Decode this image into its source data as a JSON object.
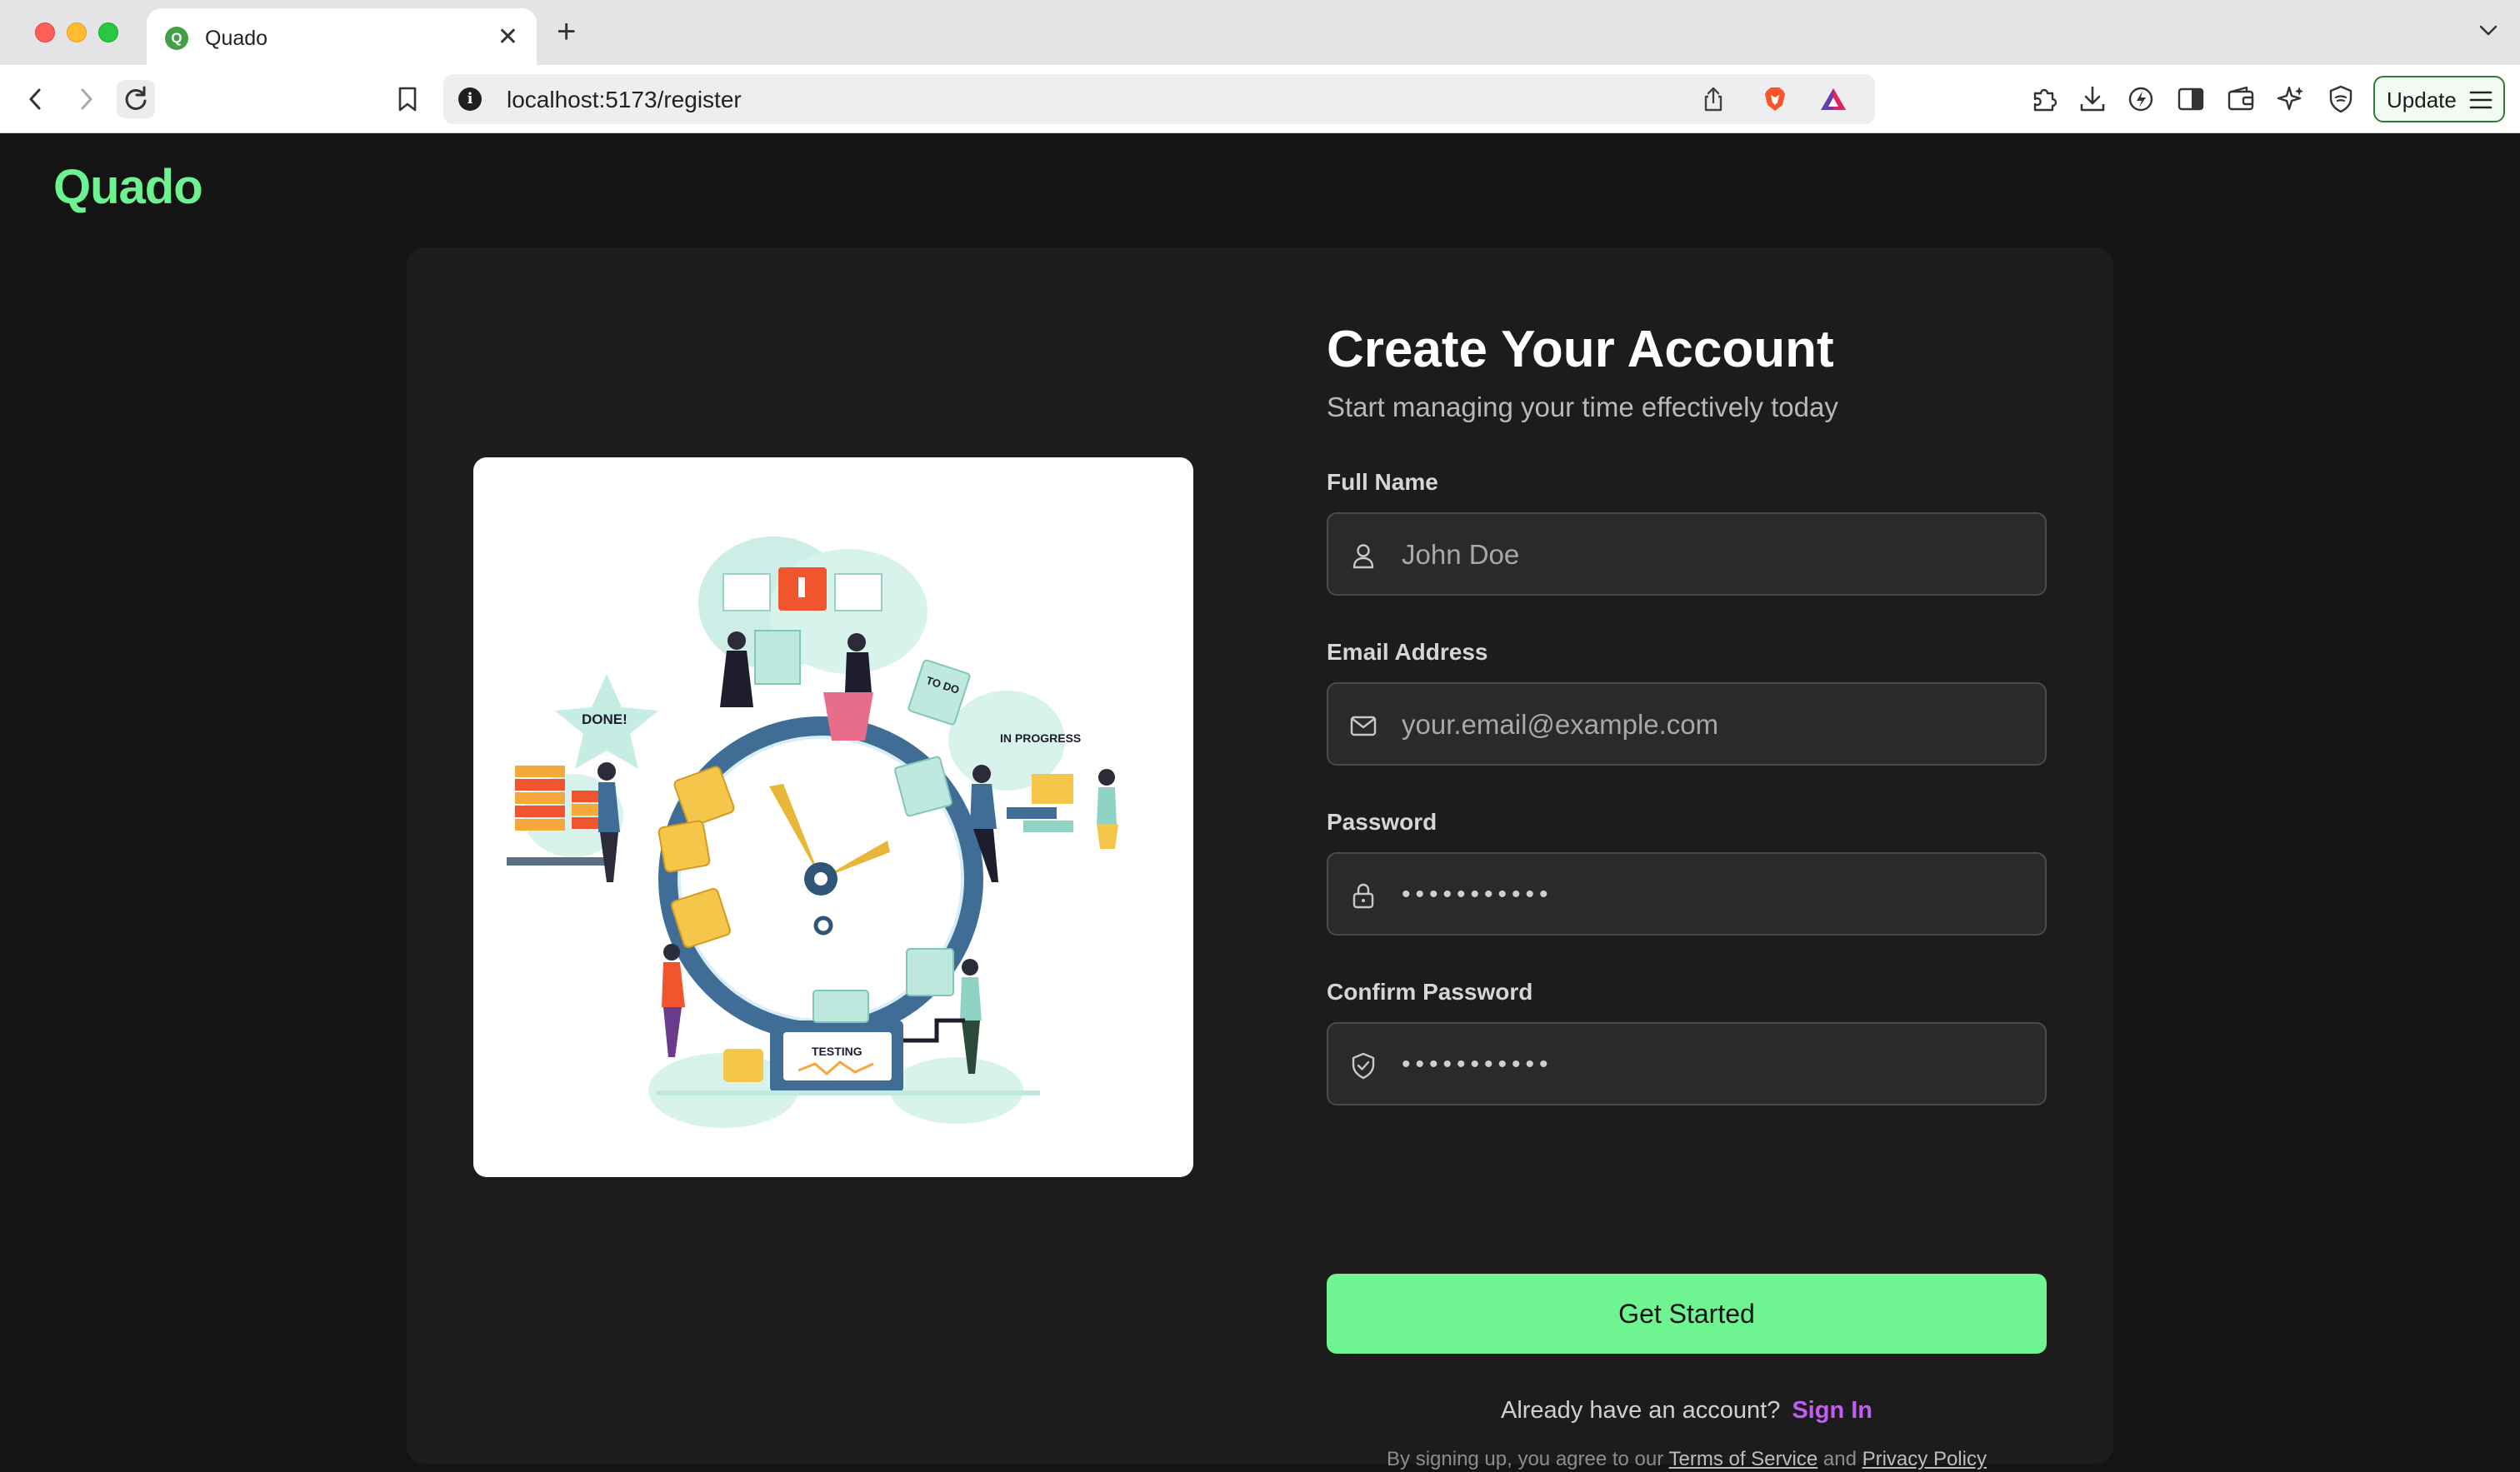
{
  "browser": {
    "tab_title": "Quado",
    "tab_favicon_letter": "Q",
    "tab_close": "✕",
    "new_tab": "+",
    "url": "localhost:5173/register",
    "update_label": "Update"
  },
  "app": {
    "brand": "Quado",
    "accent_color": "#6cf28e"
  },
  "illustration": {
    "labels": {
      "done": "DONE!",
      "todo": "TO DO",
      "in_progress": "IN PROGRESS",
      "testing": "TESTING"
    }
  },
  "form": {
    "title": "Create Your Account",
    "subtitle": "Start managing your time effectively today",
    "fields": {
      "full_name": {
        "label": "Full Name",
        "placeholder": "John Doe",
        "icon": "user-icon"
      },
      "email": {
        "label": "Email Address",
        "placeholder": "your.email@example.com",
        "icon": "mail-icon"
      },
      "password": {
        "label": "Password",
        "value": "•••••••••••",
        "icon": "lock-icon"
      },
      "confirm_password": {
        "label": "Confirm Password",
        "value": "•••••••••••",
        "icon": "shield-check-icon"
      }
    },
    "submit_label": "Get Started",
    "submit_color": "#6ef592",
    "signin_prompt": "Already have an account?",
    "signin_link": "Sign In",
    "signin_link_color": "#c35cf5",
    "terms_prefix": "By signing up, you agree to our",
    "terms_link": "Terms of Service",
    "terms_and": "and",
    "privacy_link": "Privacy Policy"
  }
}
